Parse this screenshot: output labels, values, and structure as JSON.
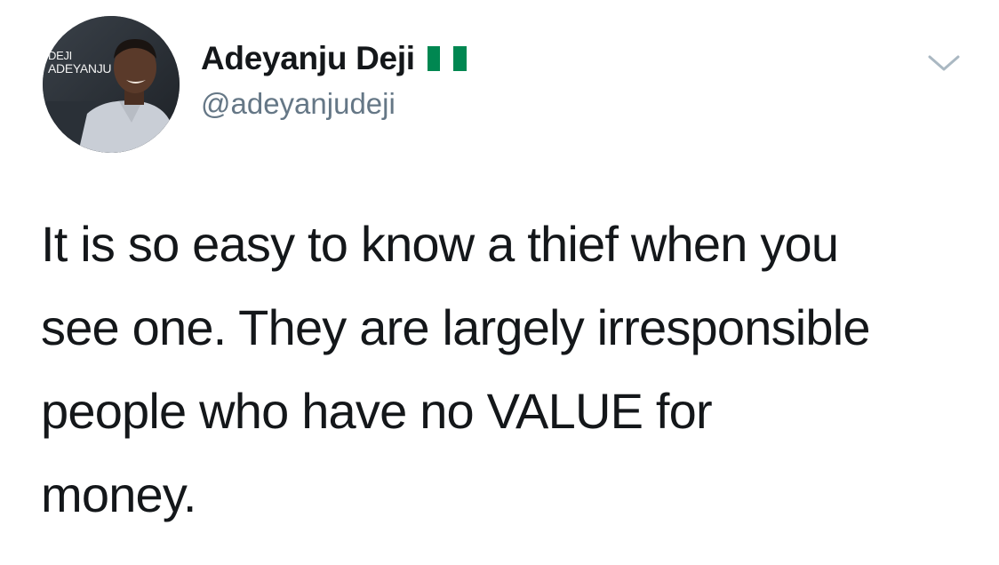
{
  "tweet": {
    "author": {
      "display_name": "Adeyanju Deji",
      "handle": "@adeyanjudeji",
      "avatar_text_line1": "DEJI",
      "avatar_text_line2": "ADEYANJU",
      "flag": {
        "icon": "nigeria-flag-icon",
        "colors": [
          "#008751",
          "#ffffff",
          "#008751"
        ]
      }
    },
    "menu_icon": "chevron-down-icon",
    "text_lines": [
      "It is so easy to know a thief when you",
      "see one. They are largely irresponsible",
      "people who have no VALUE for",
      "money."
    ]
  }
}
